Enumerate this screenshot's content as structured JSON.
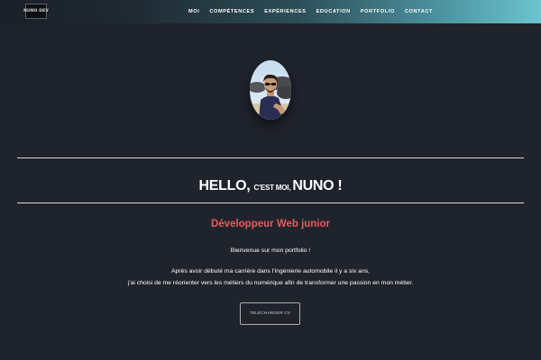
{
  "header": {
    "logo_text": "NUNO DEV",
    "nav_items": [
      {
        "label": "MOI"
      },
      {
        "label": "COMPÉTENCES"
      },
      {
        "label": "EXPÉRIENCES"
      },
      {
        "label": "EDUCATION"
      },
      {
        "label": "PORTFOLIO"
      },
      {
        "label": "CONTACT"
      }
    ]
  },
  "hero": {
    "hello_part1": "HELLO, ",
    "hello_part2": "C'EST MOI, ",
    "hello_part3": "NUNO !",
    "subtitle": "Développeur Web junior",
    "welcome": "Bienvenue sur mon portfolio !",
    "intro_line1": "Après avoir débuté ma carrière dans l'ingénierie automobile il y a six ans,",
    "intro_line2": "j'ai choisi de me réorienter vers les métiers du numérique afin de transformer une passion en mon métier.",
    "cv_button": "TELECHARGER CV"
  },
  "colors": {
    "background": "#1f232c",
    "accent": "#e85a5a",
    "nav_gradient_end": "#6cc4cf"
  }
}
